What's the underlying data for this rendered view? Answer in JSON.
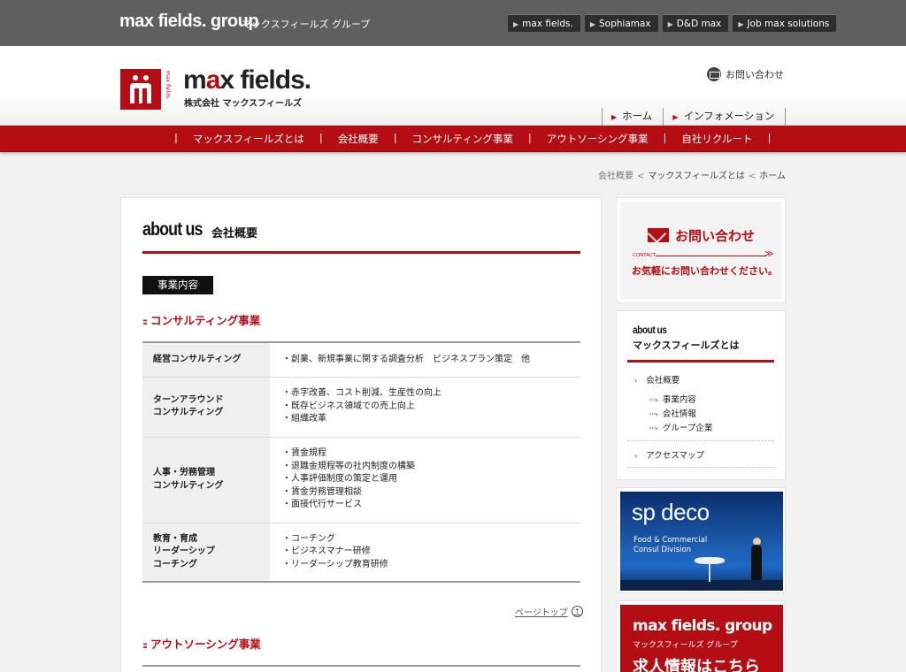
{
  "group_bar": {
    "logo": "max fields. group",
    "subtitle": "マックスフィールズ グループ",
    "links": [
      "max fields.",
      "Sophiamax",
      "D&D max",
      "Job max solutions"
    ]
  },
  "header": {
    "logo_name_prefix": "m",
    "logo_name_accent": "a",
    "logo_name_suffix": "x fields.",
    "logo_kana": "株式会社 マックスフィールズ",
    "logo_vertical": "max fields.",
    "contact_label": "お問い合わせ",
    "subnav": [
      "ホーム",
      "インフォメーション"
    ]
  },
  "main_nav": [
    "マックスフィールズとは",
    "会社概要",
    "コンサルティング事業",
    "アウトソーシング事業",
    "自社リクルート"
  ],
  "breadcrumb": [
    "会社概要",
    "マックスフィールズとは",
    "ホーム"
  ],
  "content": {
    "title_en": "about us",
    "title_jp": "会社概要",
    "section_label": "事業内容",
    "consulting_heading": "コンサルティング事業",
    "outsourcing_heading": "アウトソーシング事業",
    "page_top": "ページトップ",
    "services": [
      {
        "name": [
          "経営コンサルティング"
        ],
        "items": [
          "・創業、新規事業に関する調査分析　ビジネスプラン策定　他"
        ]
      },
      {
        "name": [
          "ターンアラウンド",
          "コンサルティング"
        ],
        "items": [
          "・赤字改善、コスト削減、生産性の向上",
          "・既存ビジネス領域での売上向上",
          "・組織改革"
        ]
      },
      {
        "name": [
          "人事・労務管理",
          "コンサルティング"
        ],
        "items": [
          "・賃金規程",
          "・退職金規程等の社内制度の構築",
          "・人事評価制度の策定と運用",
          "・賃金労務管理相談",
          "・面接代行サービス"
        ]
      },
      {
        "name": [
          "教育・育成",
          "リーダーシップ",
          "コーチング"
        ],
        "items": [
          "・コーチング",
          "・ビジネスマナー研修",
          "・リーダーシップ教育研修"
        ]
      }
    ]
  },
  "sidebar": {
    "contact_title": "お問い合わせ",
    "contact_en": "CONTACT",
    "contact_message": "お気軽にお問い合わせください。",
    "nav_en": "about us",
    "nav_jp": "マックスフィールズとは",
    "nav_company": "会社概要",
    "nav_sub": [
      "事業内容",
      "会社情報",
      "グループ企業"
    ],
    "nav_access": "アクセスマップ",
    "banner_sp_title": "sp deco",
    "banner_sp_sub1": "Food & Commercial",
    "banner_sp_sub2": "Consul Division",
    "banner_mf_title": "max fields. group",
    "banner_mf_sub": "マックスフィールズ グループ",
    "banner_mf_big": "求人情報はこちら"
  },
  "colors": {
    "brand_red": "#b40d14",
    "top_bar": "#5f5f5f"
  }
}
